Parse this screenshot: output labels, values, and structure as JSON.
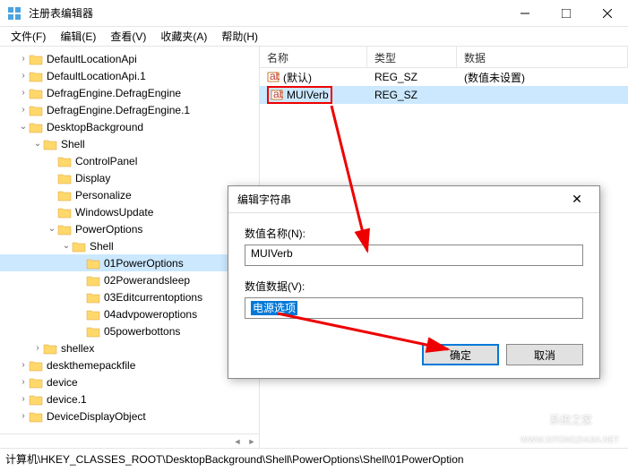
{
  "window": {
    "title": "注册表编辑器",
    "buttons": {
      "min": "minimize",
      "max": "maximize",
      "close": "close"
    }
  },
  "menubar": {
    "items": [
      "文件(F)",
      "编辑(E)",
      "查看(V)",
      "收藏夹(A)",
      "帮助(H)"
    ]
  },
  "tree": {
    "items": [
      {
        "label": "DefaultLocationApi",
        "indent": 1,
        "expander": ">"
      },
      {
        "label": "DefaultLocationApi.1",
        "indent": 1,
        "expander": ">"
      },
      {
        "label": "DefragEngine.DefragEngine",
        "indent": 1,
        "expander": ">"
      },
      {
        "label": "DefragEngine.DefragEngine.1",
        "indent": 1,
        "expander": ">"
      },
      {
        "label": "DesktopBackground",
        "indent": 1,
        "expander": "v"
      },
      {
        "label": "Shell",
        "indent": 2,
        "expander": "v"
      },
      {
        "label": "ControlPanel",
        "indent": 3,
        "expander": ""
      },
      {
        "label": "Display",
        "indent": 3,
        "expander": ""
      },
      {
        "label": "Personalize",
        "indent": 3,
        "expander": ""
      },
      {
        "label": "WindowsUpdate",
        "indent": 3,
        "expander": ""
      },
      {
        "label": "PowerOptions",
        "indent": 3,
        "expander": "v"
      },
      {
        "label": "Shell",
        "indent": 4,
        "expander": "v"
      },
      {
        "label": "01PowerOptions",
        "indent": 5,
        "expander": "",
        "selected": true
      },
      {
        "label": "02Powerandsleep",
        "indent": 5,
        "expander": ""
      },
      {
        "label": "03Editcurrentoptions",
        "indent": 5,
        "expander": ""
      },
      {
        "label": "04advpoweroptions",
        "indent": 5,
        "expander": ""
      },
      {
        "label": "05powerbottons",
        "indent": 5,
        "expander": ""
      },
      {
        "label": "shellex",
        "indent": 2,
        "expander": ">"
      },
      {
        "label": "deskthemepackfile",
        "indent": 1,
        "expander": ">"
      },
      {
        "label": "device",
        "indent": 1,
        "expander": ">"
      },
      {
        "label": "device.1",
        "indent": 1,
        "expander": ">"
      },
      {
        "label": "DeviceDisplayObject",
        "indent": 1,
        "expander": ">"
      }
    ]
  },
  "list": {
    "headers": {
      "name": "名称",
      "type": "类型",
      "data": "数据"
    },
    "rows": [
      {
        "name": "(默认)",
        "type": "REG_SZ",
        "data": "(数值未设置)",
        "highlighted": false
      },
      {
        "name": "MUIVerb",
        "type": "REG_SZ",
        "data": "",
        "highlighted": true,
        "redbox": true
      }
    ]
  },
  "dialog": {
    "title": "编辑字符串",
    "name_label": "数值名称(N):",
    "name_value": "MUIVerb",
    "data_label": "数值数据(V):",
    "data_value": "电源选项",
    "ok": "确定",
    "cancel": "取消"
  },
  "statusbar": {
    "path": "计算机\\HKEY_CLASSES_ROOT\\DesktopBackground\\Shell\\PowerOptions\\Shell\\01PowerOption"
  },
  "watermark": {
    "text": "系统之家",
    "url": "WWW.XITONGZHIJIA.NET"
  }
}
